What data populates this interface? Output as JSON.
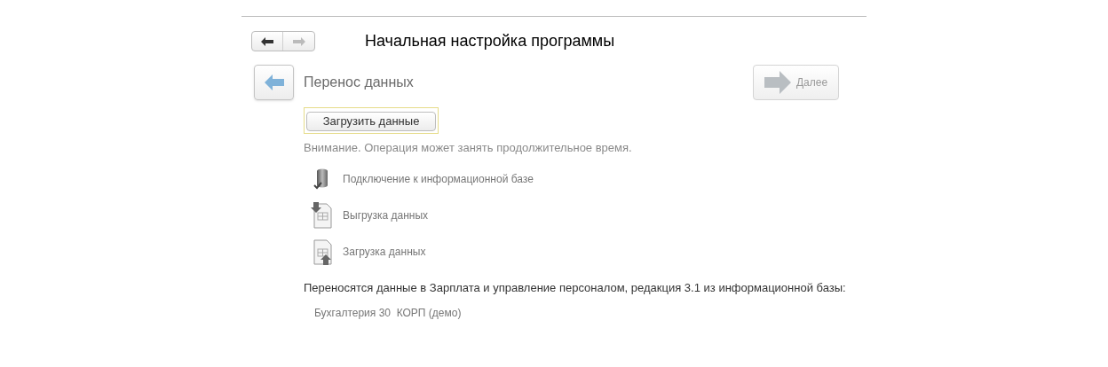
{
  "window": {
    "title": "Начальная настройка программы"
  },
  "nav": {
    "back_disabled": false,
    "forward_disabled": true
  },
  "page": {
    "title": "Перенос данных",
    "back_disabled": false,
    "next": {
      "label": "Далее",
      "disabled": true
    }
  },
  "load_button": {
    "label": "Загрузить данные",
    "focused": true
  },
  "warning": "Внимание. Операция может занять продолжительное время.",
  "steps": [
    {
      "kind": "database",
      "label": "Подключение к информационной базе"
    },
    {
      "kind": "export",
      "label": "Выгрузка данных"
    },
    {
      "kind": "import",
      "label": "Загрузка данных"
    }
  ],
  "info": "Переносятся данные в Зарплата и управление персоналом, редакция 3.1 из информационной базы:",
  "source_base": "Бухгалтерия 30  КОРП (демо)"
}
